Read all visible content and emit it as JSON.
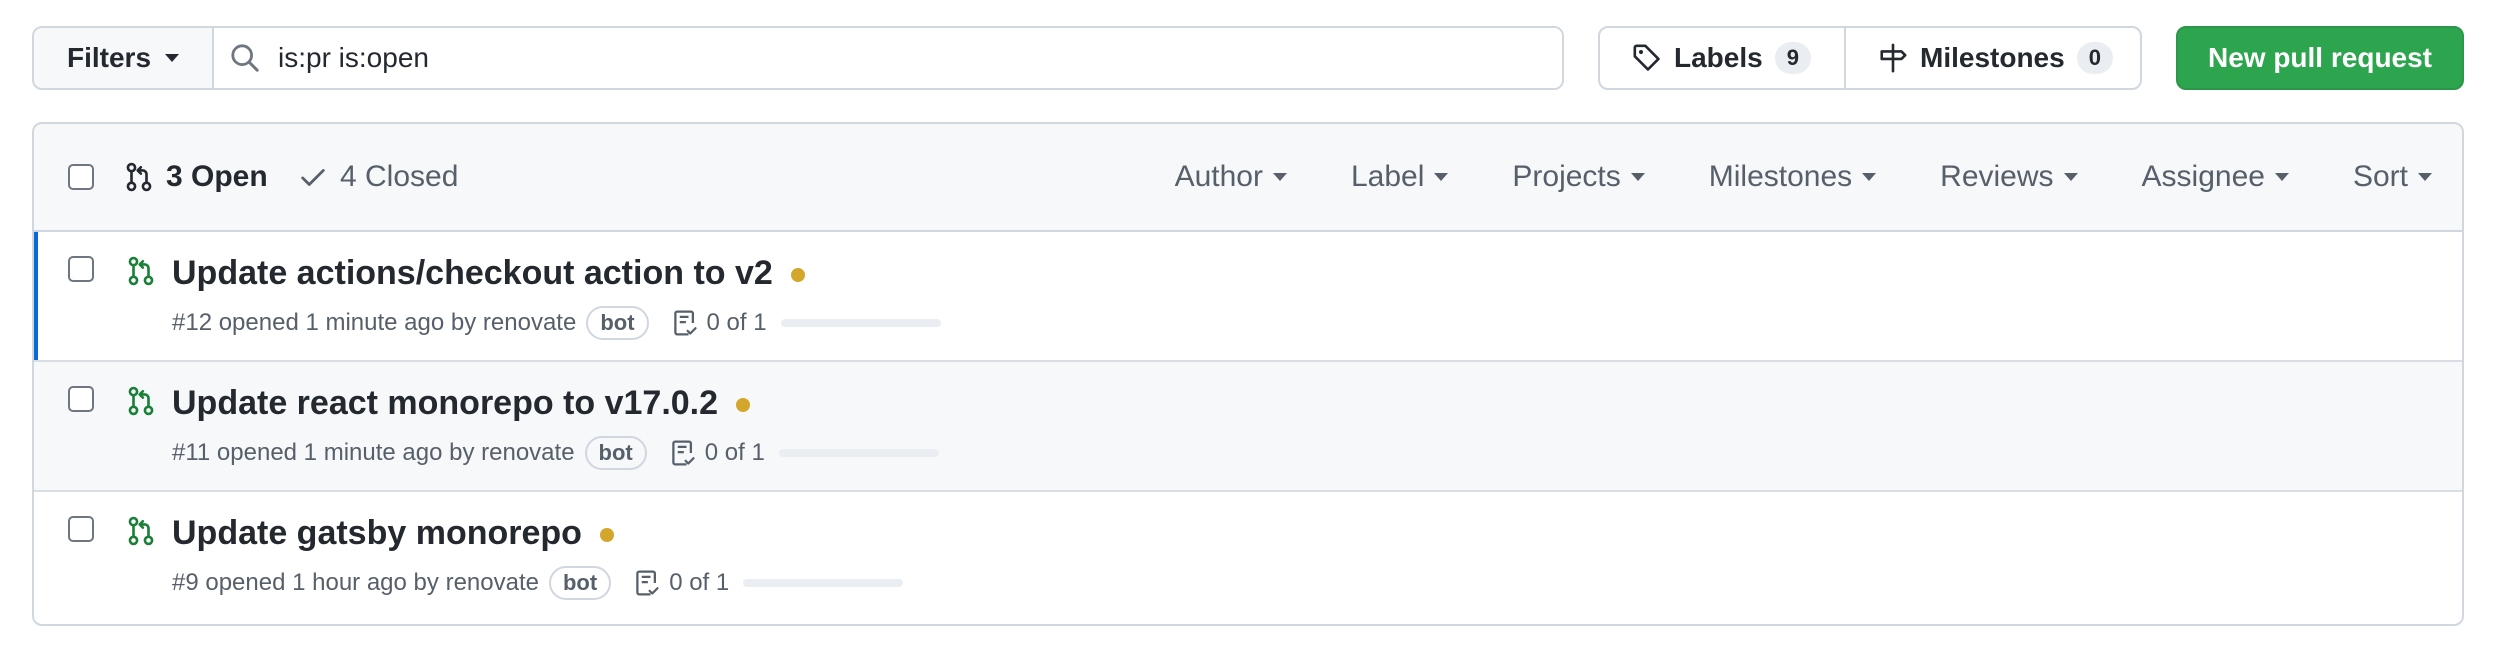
{
  "toolbar": {
    "filters_label": "Filters",
    "search_value": "is:pr is:open",
    "labels_label": "Labels",
    "labels_count": "9",
    "milestones_label": "Milestones",
    "milestones_count": "0",
    "new_pr_label": "New pull request"
  },
  "list_header": {
    "open_label": "3 Open",
    "closed_label": "4 Closed",
    "menus": [
      "Author",
      "Label",
      "Projects",
      "Milestones",
      "Reviews",
      "Assignee",
      "Sort"
    ]
  },
  "pull_requests": [
    {
      "title": "Update actions/checkout action to v2",
      "meta": "#12 opened 1 minute ago by",
      "author": "renovate",
      "badge": "bot",
      "review": "0 of 1",
      "review_progress": 0
    },
    {
      "title": "Update react monorepo to v17.0.2",
      "meta": "#11 opened 1 minute ago by",
      "author": "renovate",
      "badge": "bot",
      "review": "0 of 1",
      "review_progress": 0
    },
    {
      "title": "Update gatsby monorepo",
      "meta": "#9 opened 1 hour ago by",
      "author": "renovate",
      "badge": "bot",
      "review": "0 of 1",
      "review_progress": 0
    }
  ],
  "colors": {
    "accent_green": "#2da44e",
    "open_icon_green": "#1a7f37",
    "status_pending": "#d4a72c",
    "active_row_bar": "#0969da"
  },
  "icons": {
    "search": "search-icon",
    "tag": "tag-icon",
    "milestone": "milestone-icon",
    "pr_open": "git-pull-request-icon",
    "check": "check-icon",
    "review": "review-checklist-icon"
  }
}
